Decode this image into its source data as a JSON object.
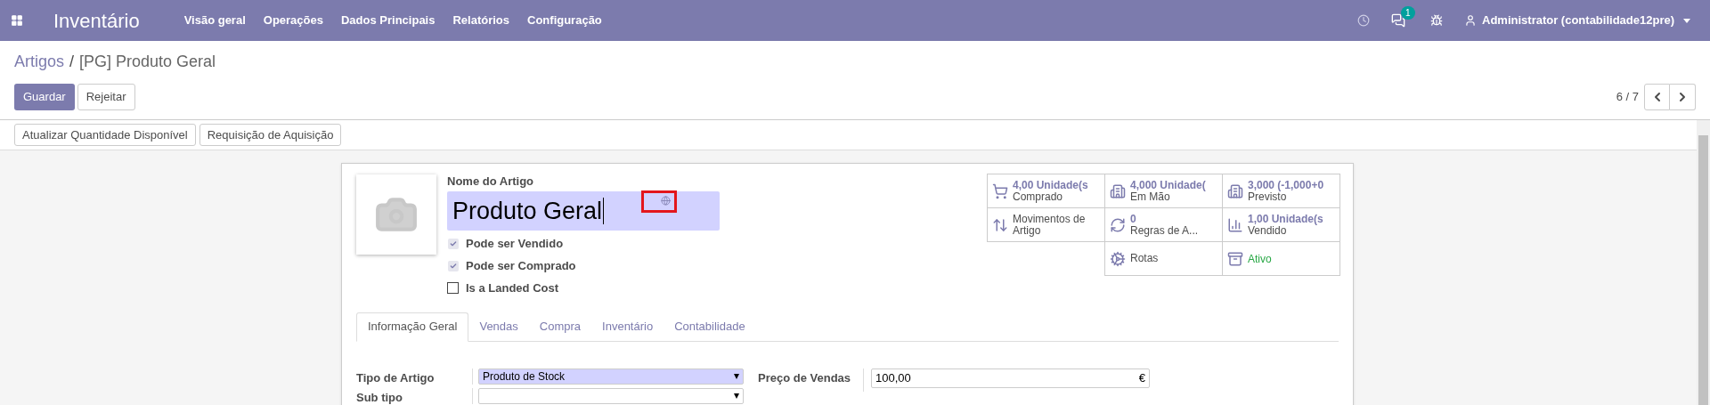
{
  "navbar": {
    "app_title": "Inventário",
    "menu": [
      "Visão geral",
      "Operações",
      "Dados Principais",
      "Relatórios",
      "Configuração"
    ],
    "messages_badge": "1",
    "user": "Administrator (contabilidade12pre)"
  },
  "breadcrumb": {
    "parent": "Artigos",
    "separator": "/",
    "current": "[PG] Produto Geral"
  },
  "buttons": {
    "save": "Guardar",
    "discard": "Rejeitar"
  },
  "pager": "6 / 7",
  "actions": [
    "Atualizar Quantidade Disponível",
    "Requisição de Aquisição"
  ],
  "form": {
    "name_label": "Nome do Artigo",
    "name_value": "Produto Geral",
    "checkboxes": [
      {
        "label": "Pode ser Vendido",
        "checked": true
      },
      {
        "label": "Pode ser Comprado",
        "checked": true
      },
      {
        "label": "Is a Landed Cost",
        "checked": false
      }
    ],
    "stat_buttons": [
      {
        "kind": "stat",
        "value": "4,00 Unidade(s",
        "label": "Comprado"
      },
      {
        "kind": "stat",
        "value": "4,000 Unidade(",
        "label": "Em Mão"
      },
      {
        "kind": "stat",
        "value": "3,000 (-1,000+0",
        "label": "Previsto"
      },
      {
        "kind": "link",
        "label": "Movimentos de Artigo"
      },
      {
        "kind": "stat",
        "value": "0",
        "label": "Regras de A..."
      },
      {
        "kind": "stat",
        "value": "1,00 Unidade(s",
        "label": "Vendido"
      },
      {
        "kind": "link",
        "label": "Rotas"
      },
      {
        "kind": "toggle",
        "label": "Ativo",
        "active": true
      }
    ],
    "tabs": [
      {
        "label": "Informação Geral",
        "selected": true
      },
      {
        "label": "Vendas",
        "selected": false
      },
      {
        "label": "Compra",
        "selected": false
      },
      {
        "label": "Inventário",
        "selected": false
      },
      {
        "label": "Contabilidade",
        "selected": false
      }
    ],
    "fields_left": [
      {
        "label": "Tipo de Artigo",
        "value": "Produto de Stock",
        "required": true
      },
      {
        "label": "Sub tipo",
        "required": false
      }
    ],
    "fields_right": [
      {
        "label": "Preço de Vendas",
        "value": "100,00",
        "currency": "€"
      }
    ]
  }
}
